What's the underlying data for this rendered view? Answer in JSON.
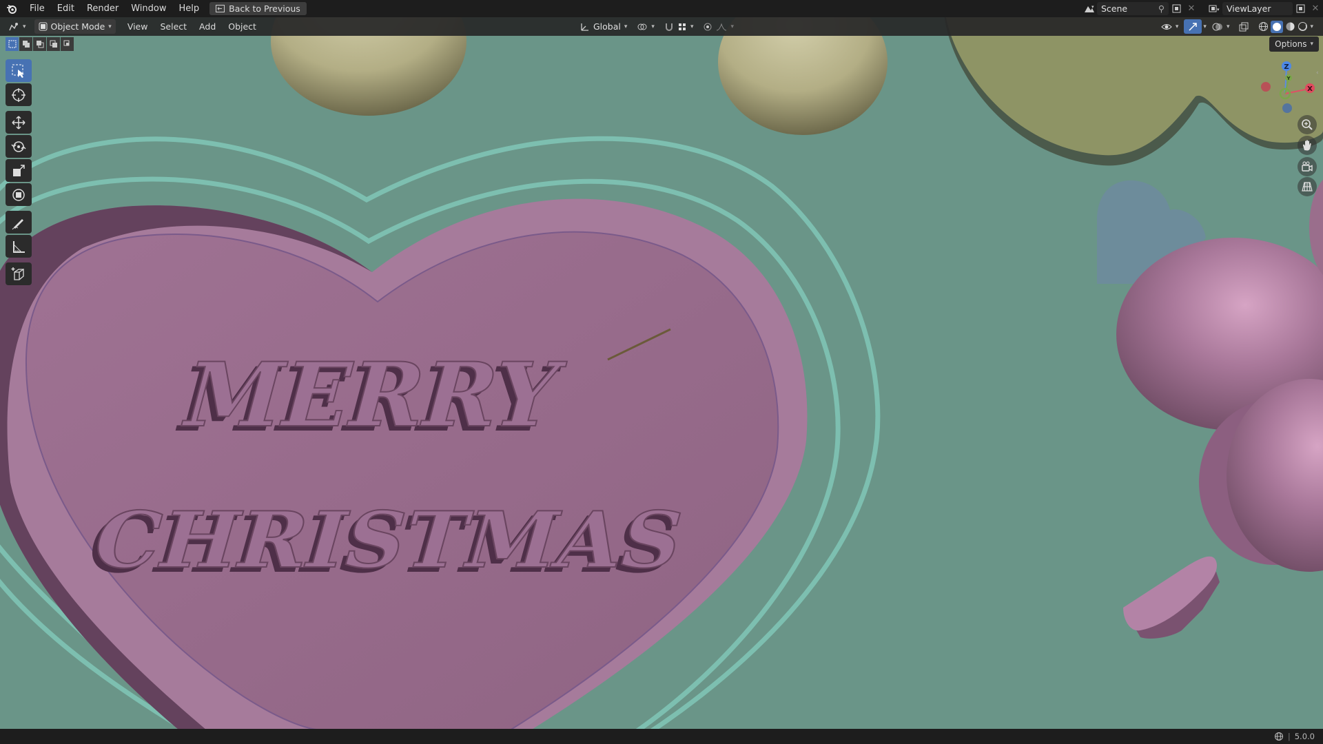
{
  "topbar": {
    "menus": [
      "File",
      "Edit",
      "Render",
      "Window",
      "Help"
    ],
    "back_button": "Back to Previous",
    "scene_name": "Scene",
    "view_layer": "ViewLayer"
  },
  "header": {
    "mode": "Object Mode",
    "menus": [
      "View",
      "Select",
      "Add",
      "Object"
    ],
    "transform_orientation": "Global"
  },
  "options_label": "Options",
  "viewport": {
    "text_line1": "MERRY",
    "text_line2": "CHRISTMAS",
    "gizmo_axes": {
      "z": "Z",
      "y": "Y",
      "x": "X"
    }
  },
  "statusbar": {
    "version": "5.0.0"
  },
  "colors": {
    "viewport_bg": "#6a9588",
    "heart_pink": "#9a6e8c",
    "outline_teal": "#7dbfb0",
    "sphere_olive": "#b3b08a",
    "accent_blue": "#4772b3"
  }
}
